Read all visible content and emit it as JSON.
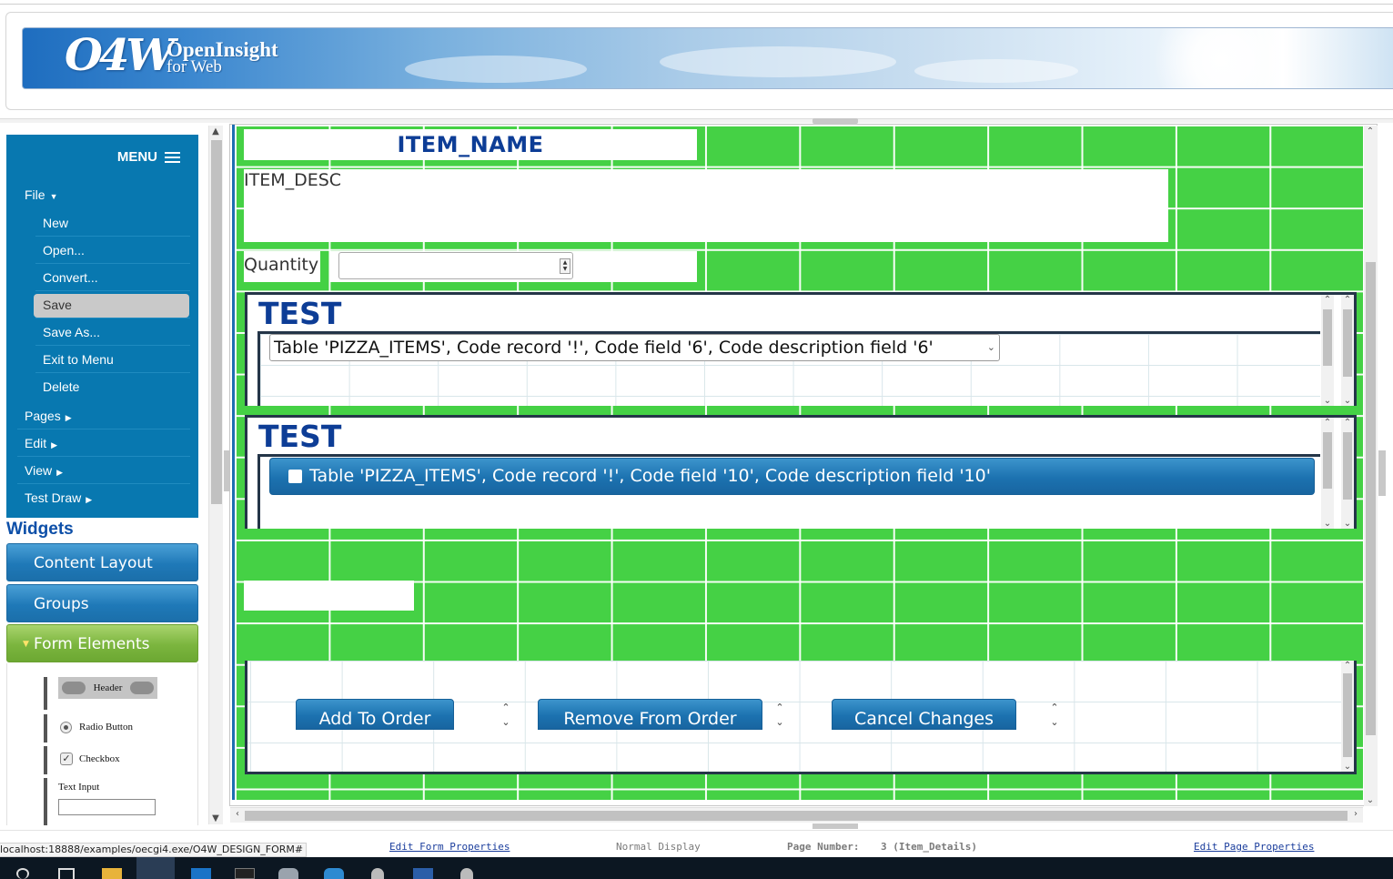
{
  "banner": {
    "logo_mark": "O4W",
    "logo_line1": "OpenInsight",
    "logo_line2": "for Web"
  },
  "menu": {
    "title": "MENU",
    "items": [
      {
        "label": "File",
        "arrow": "▼",
        "level": 0
      },
      {
        "label": "New",
        "arrow": "",
        "level": 1
      },
      {
        "label": "Open...",
        "arrow": "",
        "level": 1
      },
      {
        "label": "Convert...",
        "arrow": "",
        "level": 1
      },
      {
        "label": "Save",
        "arrow": "",
        "level": 1,
        "active": true
      },
      {
        "label": "Save As...",
        "arrow": "",
        "level": 1
      },
      {
        "label": "Exit to Menu",
        "arrow": "",
        "level": 1
      },
      {
        "label": "Delete",
        "arrow": "",
        "level": 1
      },
      {
        "label": "Pages",
        "arrow": "▶",
        "level": 0
      },
      {
        "label": "Edit",
        "arrow": "▶",
        "level": 0
      },
      {
        "label": "View",
        "arrow": "▶",
        "level": 0
      },
      {
        "label": "Test Draw",
        "arrow": "▶",
        "level": 0
      }
    ]
  },
  "widgets": {
    "title": "Widgets",
    "sections": {
      "content_layout": "Content Layout",
      "groups": "Groups",
      "form_elements": "Form Elements"
    },
    "form_elements": {
      "header": "Header",
      "radio": "Radio Button",
      "checkbox": "Checkbox",
      "text_input": "Text Input"
    }
  },
  "form": {
    "item_name": "ITEM_NAME",
    "item_desc": "ITEM_DESC",
    "quantity_label": "Quantity",
    "quantity_value": "",
    "panel1": {
      "title": "TEST",
      "select_value": "Table 'PIZZA_ITEMS', Code record '!', Code field '6', Code description field '6'"
    },
    "panel2": {
      "title": "TEST",
      "checkbox_label": "Table 'PIZZA_ITEMS', Code record '!', Code field '10', Code description field '10'"
    },
    "buttons": {
      "add": "Add To Order",
      "remove": "Remove From Order",
      "cancel": "Cancel Changes"
    }
  },
  "status": {
    "url": "localhost:18888/examples/oecgi4.exe/O4W_DESIGN_FORM#",
    "edit_form": "Edit Form Properties",
    "display_mode": "Normal Display",
    "page_label": "Page Number:",
    "page_value": "3 (Item_Details)",
    "edit_page": "Edit Page Properties"
  },
  "colors": {
    "menu_bg": "#0878b0",
    "canvas_green": "#45d145",
    "title_blue": "#0d3d96",
    "button_blue": "#1c72b0",
    "accordion_green": "#7bb53e"
  },
  "icons": {
    "menu": "hamburger-icon",
    "select": "chevron-down-icon",
    "spinner": "spinner-arrows-icon"
  }
}
